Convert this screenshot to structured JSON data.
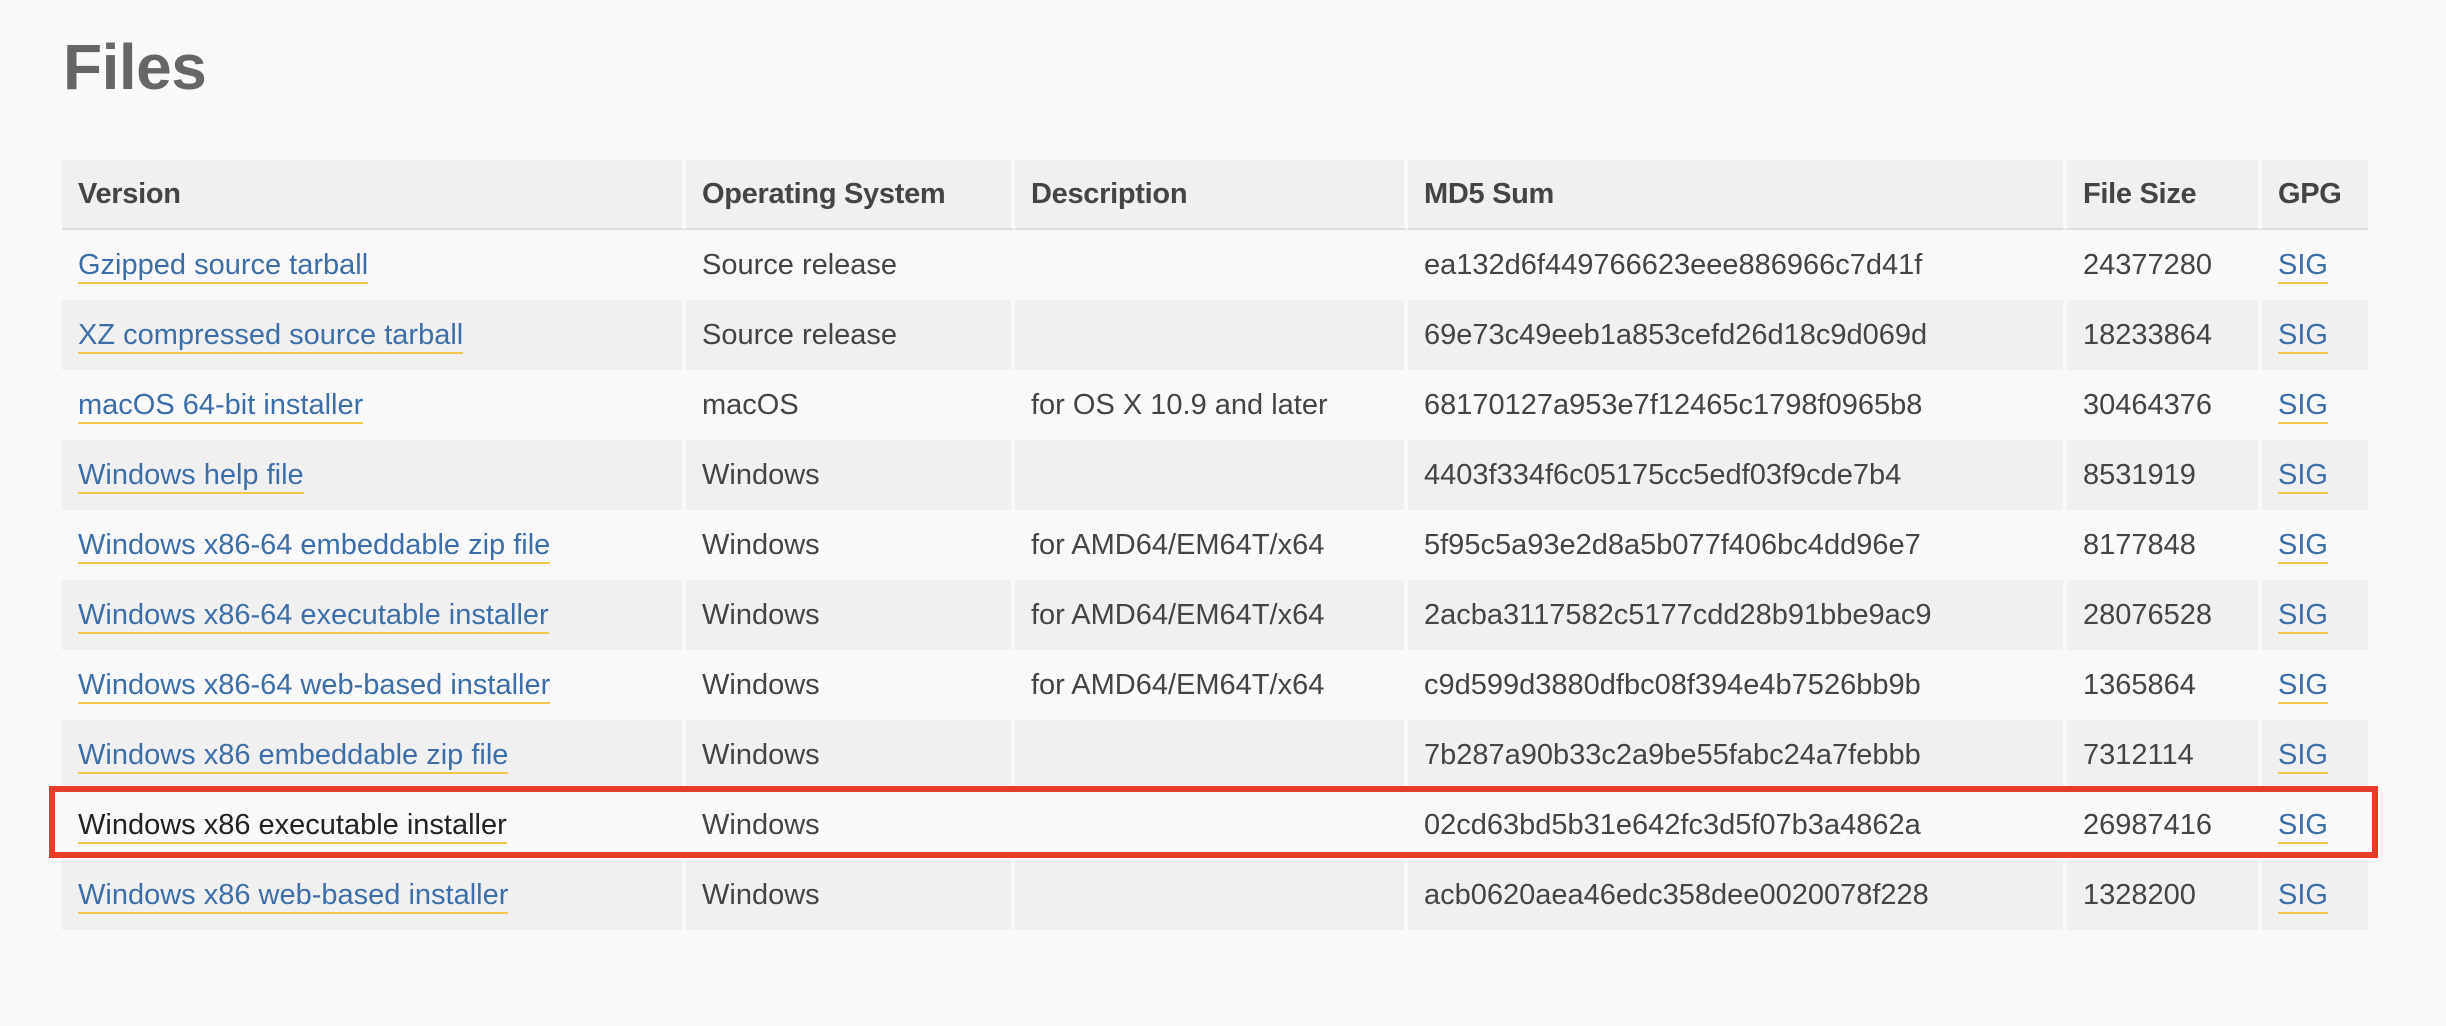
{
  "page": {
    "title": "Files"
  },
  "colors": {
    "link": "#3c6fa8",
    "link_underline": "#f2c94c",
    "highlight": "#e43e2b",
    "row_alt": "#f0f0f0",
    "background": "#f9f9f9"
  },
  "table": {
    "headers": {
      "version": "Version",
      "os": "Operating System",
      "description": "Description",
      "md5": "MD5 Sum",
      "size": "File Size",
      "gpg": "GPG"
    },
    "rows": [
      {
        "version": "Gzipped source tarball",
        "os": "Source release",
        "description": "",
        "md5": "ea132d6f449766623eee886966c7d41f",
        "size": "24377280",
        "gpg": "SIG"
      },
      {
        "version": "XZ compressed source tarball",
        "os": "Source release",
        "description": "",
        "md5": "69e73c49eeb1a853cefd26d18c9d069d",
        "size": "18233864",
        "gpg": "SIG"
      },
      {
        "version": "macOS 64-bit installer",
        "os": "macOS",
        "description": "for OS X 10.9 and later",
        "md5": "68170127a953e7f12465c1798f0965b8",
        "size": "30464376",
        "gpg": "SIG"
      },
      {
        "version": "Windows help file",
        "os": "Windows",
        "description": "",
        "md5": "4403f334f6c05175cc5edf03f9cde7b4",
        "size": "8531919",
        "gpg": "SIG"
      },
      {
        "version": "Windows x86-64 embeddable zip file",
        "os": "Windows",
        "description": "for AMD64/EM64T/x64",
        "md5": "5f95c5a93e2d8a5b077f406bc4dd96e7",
        "size": "8177848",
        "gpg": "SIG"
      },
      {
        "version": "Windows x86-64 executable installer",
        "os": "Windows",
        "description": "for AMD64/EM64T/x64",
        "md5": "2acba3117582c5177cdd28b91bbe9ac9",
        "size": "28076528",
        "gpg": "SIG"
      },
      {
        "version": "Windows x86-64 web-based installer",
        "os": "Windows",
        "description": "for AMD64/EM64T/x64",
        "md5": "c9d599d3880dfbc08f394e4b7526bb9b",
        "size": "1365864",
        "gpg": "SIG"
      },
      {
        "version": "Windows x86 embeddable zip file",
        "os": "Windows",
        "description": "",
        "md5": "7b287a90b33c2a9be55fabc24a7febbb",
        "size": "7312114",
        "gpg": "SIG"
      },
      {
        "version": "Windows x86 executable installer",
        "os": "Windows",
        "description": "",
        "md5": "02cd63bd5b31e642fc3d5f07b3a4862a",
        "size": "26987416",
        "gpg": "SIG"
      },
      {
        "version": "Windows x86 web-based installer",
        "os": "Windows",
        "description": "",
        "md5": "acb0620aea46edc358dee0020078f228",
        "size": "1328200",
        "gpg": "SIG"
      }
    ]
  }
}
